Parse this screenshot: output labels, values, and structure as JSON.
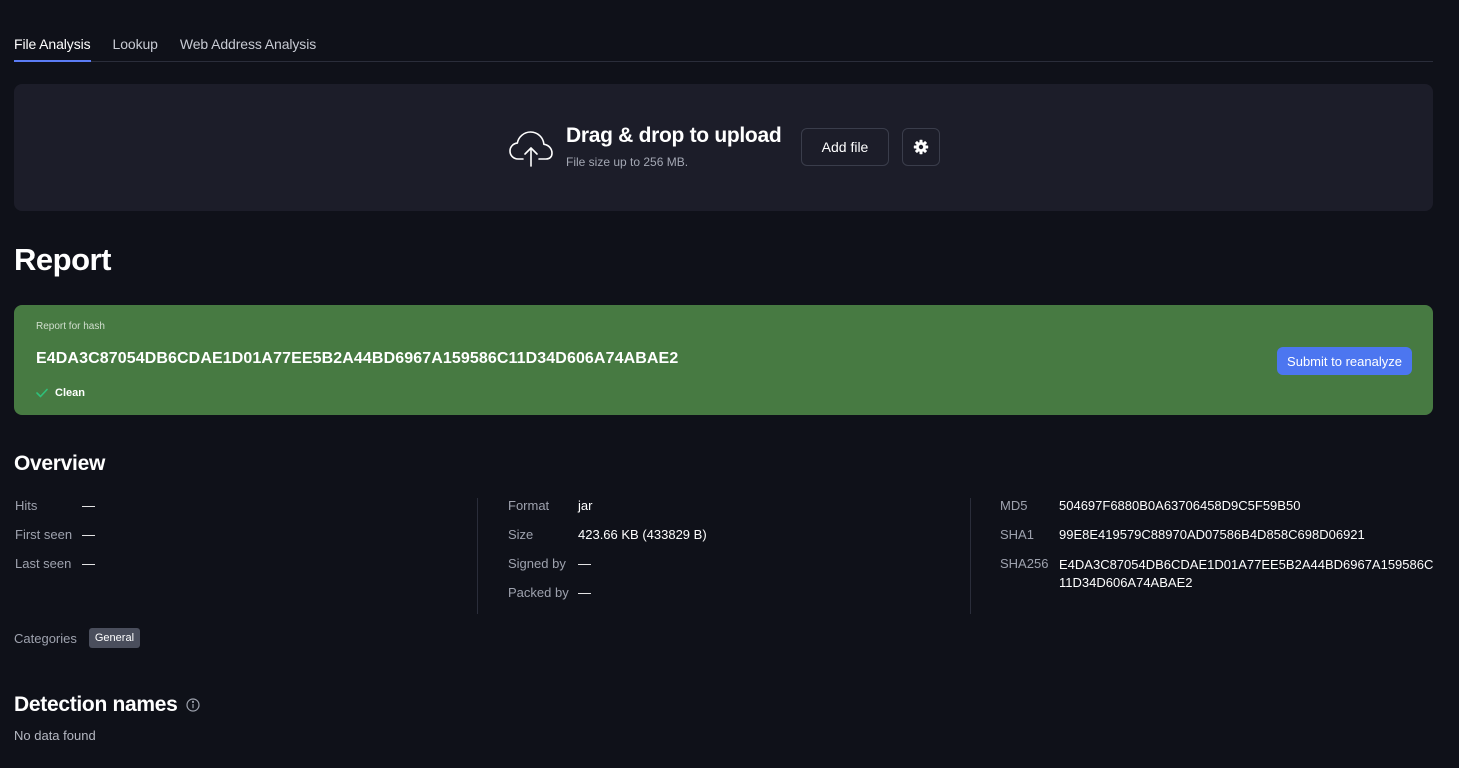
{
  "tabs": [
    {
      "label": "File Analysis",
      "active": true
    },
    {
      "label": "Lookup",
      "active": false
    },
    {
      "label": "Web Address Analysis",
      "active": false
    }
  ],
  "upload": {
    "title": "Drag & drop to upload",
    "subtitle": "File size up to 256 MB.",
    "add_file_label": "Add file",
    "cloud_icon": "cloud-upload-icon",
    "settings_icon": "gear-icon"
  },
  "report": {
    "title": "Report",
    "banner": {
      "label": "Report for hash",
      "hash": "E4DA3C87054DB6CDAE1D01A77EE5B2A44BD6967A159586C11D34D606A74ABAE2",
      "status": "Clean",
      "status_color": "#2fc07a",
      "background_color": "#477a42",
      "reanalyze_label": "Submit to reanalyze"
    }
  },
  "overview": {
    "title": "Overview",
    "col1": [
      {
        "label": "Hits",
        "value": "—"
      },
      {
        "label": "First seen",
        "value": "—"
      },
      {
        "label": "Last seen",
        "value": "—"
      }
    ],
    "col2": [
      {
        "label": "Format",
        "value": "jar"
      },
      {
        "label": "Size",
        "value": "423.66 KB (433829 B)"
      },
      {
        "label": "Signed by",
        "value": "—"
      },
      {
        "label": "Packed by",
        "value": "—"
      }
    ],
    "col3": [
      {
        "label": "MD5",
        "value": "504697F6880B0A63706458D9C5F59B50"
      },
      {
        "label": "SHA1",
        "value": "99E8E419579C88970AD07586B4D858C698D06921"
      },
      {
        "label": "SHA256",
        "value": "E4DA3C87054DB6CDAE1D01A77EE5B2A44BD6967A159586C11D34D606A74ABAE2"
      }
    ],
    "categories_label": "Categories",
    "categories": [
      "General"
    ]
  },
  "detection": {
    "title": "Detection names",
    "info_icon": "info-icon",
    "empty_text": "No data found"
  }
}
